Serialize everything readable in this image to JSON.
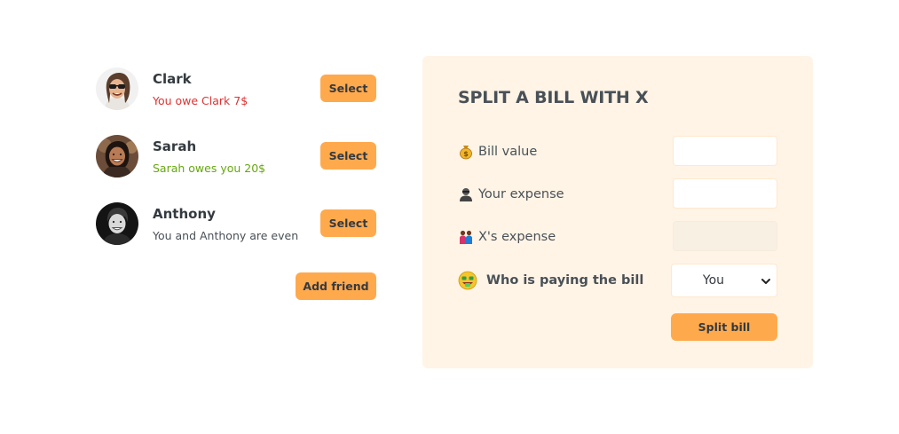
{
  "friends": [
    {
      "name": "Clark",
      "status": "You owe Clark 7$",
      "status_type": "owe",
      "select_label": "Select"
    },
    {
      "name": "Sarah",
      "status": "Sarah owes you 20$",
      "status_type": "owed",
      "select_label": "Select"
    },
    {
      "name": "Anthony",
      "status": "You and Anthony are even",
      "status_type": "even",
      "select_label": "Select"
    }
  ],
  "add_friend_label": "Add friend",
  "split_form": {
    "title": "SPLIT A BILL WITH X",
    "bill_value": {
      "label": "Bill value",
      "icon": "money-bag-icon",
      "value": ""
    },
    "your_expense": {
      "label": "Your expense",
      "icon": "person-icon",
      "value": ""
    },
    "x_expense": {
      "label": "X's expense",
      "icon": "couple-icon",
      "value": ""
    },
    "payer": {
      "label": "Who is paying the bill",
      "icon": "money-face-icon",
      "selected": "You"
    },
    "submit_label": "Split bill"
  },
  "colors": {
    "accent": "#ffa94d",
    "panel_bg": "#fff4e6",
    "owe": "#e03131",
    "owed": "#66a80f",
    "text": "#495057"
  }
}
